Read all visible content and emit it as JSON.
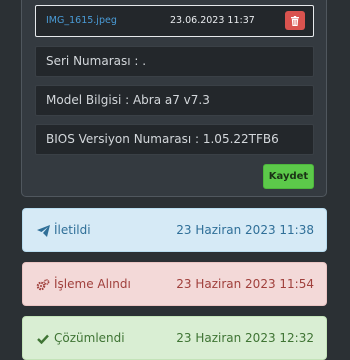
{
  "attachment": {
    "file_name": "IMG_1615.jpeg",
    "date": "23.06.2023 11:37"
  },
  "fields": {
    "serial": "Seri Numarası : .",
    "model": "Model Bilgisi : Abra a7 v7.3",
    "bios": "BIOS Versiyon Numarası : 1.05.22TFB6"
  },
  "save_label": "Kaydet",
  "statuses": [
    {
      "label": "İletildi",
      "date": "23 Haziran 2023 11:38",
      "icon": "paper-plane-icon"
    },
    {
      "label": "İşleme Alındı",
      "date": "23 Haziran 2023 11:54",
      "icon": "cogs-icon"
    },
    {
      "label": "Çözümlendi",
      "date": "23 Haziran 2023 12:32",
      "icon": "check-icon"
    }
  ],
  "colors": {
    "sent": "#2f6f98",
    "processing": "#a0403c",
    "resolved": "#3f7434",
    "save": "#5cc94a",
    "delete": "#d9534f"
  }
}
